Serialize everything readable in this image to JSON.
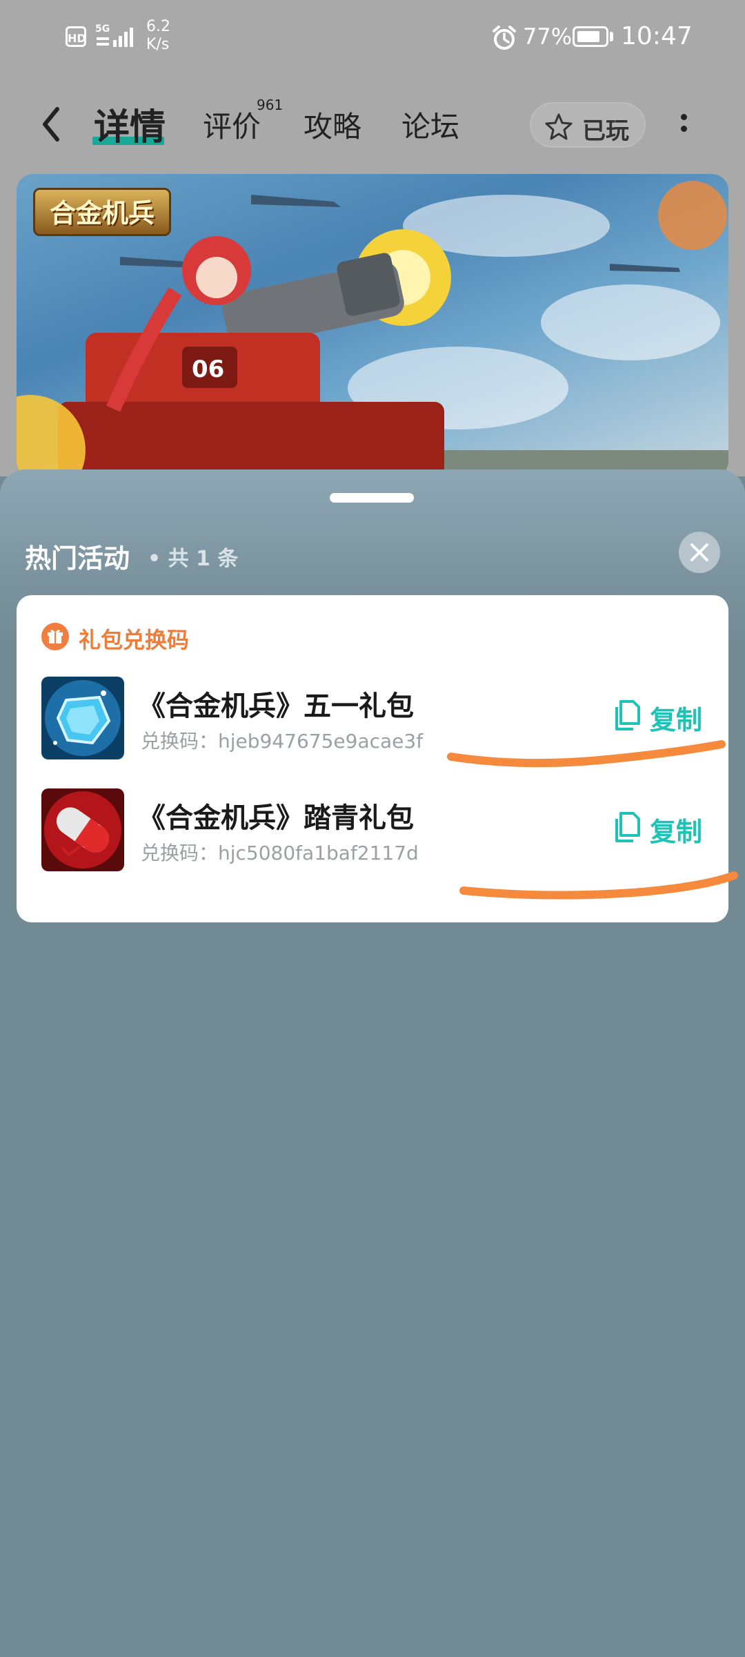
{
  "status_bar": {
    "hd": "HD",
    "network": "5G",
    "speed_value": "6.2",
    "speed_unit": "K/s",
    "battery": "77%",
    "battery_level": 0.77,
    "time": "10:47"
  },
  "nav": {
    "tabs": [
      {
        "label": "详情",
        "active": true
      },
      {
        "label": "评价",
        "badge": "961"
      },
      {
        "label": "攻略"
      },
      {
        "label": "论坛"
      }
    ],
    "played_label": "已玩"
  },
  "banner": {
    "logo_text": "合金机兵"
  },
  "sheet": {
    "title": "热门活动",
    "count_text": "• 共 1 条",
    "section_title": "礼包兑换码",
    "gifts": [
      {
        "name": "《合金机兵》五一礼包",
        "code": "兑换码：hjeb947675e9acae3f",
        "copy_label": "复制",
        "icon": "blue-crystal-icon"
      },
      {
        "name": "《合金机兵》踏青礼包",
        "code": "兑换码：hjc5080fa1baf2117d",
        "copy_label": "复制",
        "icon": "red-capsule-icon"
      }
    ]
  },
  "colors": {
    "accent_teal": "#1ec2b6",
    "accent_orange": "#ef7d3a",
    "tab_underline": "#1aa89a"
  }
}
